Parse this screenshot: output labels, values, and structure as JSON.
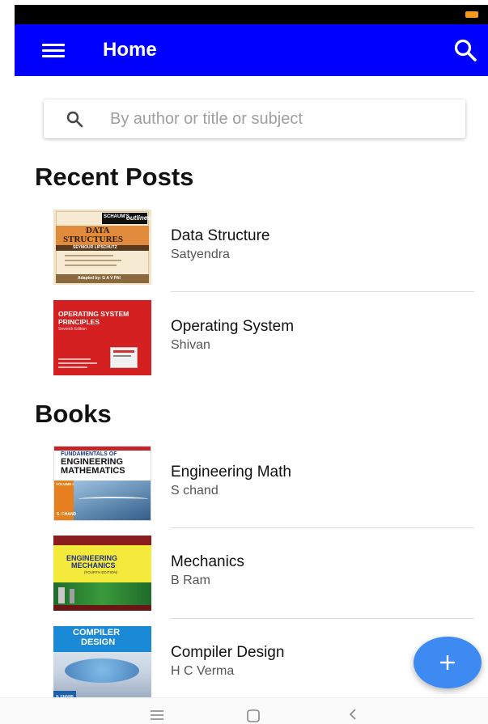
{
  "app_bar": {
    "title": "Home"
  },
  "search": {
    "placeholder": "By author or title or subject"
  },
  "sections": {
    "recent_title": "Recent Posts",
    "books_title": "Books"
  },
  "recent_posts": [
    {
      "title": "Data Structure",
      "author": "Satyendra",
      "cover": {
        "series": "SCHAUM'S",
        "series2": "outlines",
        "line1": "DATA",
        "line2": "STRUCTURES",
        "byline": "SEYMOUR LIPSCHUTZ",
        "footer": "Adapted by: G A V PAI"
      }
    },
    {
      "title": "Operating System",
      "author": "Shivan",
      "cover": {
        "line1": "OPERATING SYSTEM",
        "line2": "PRINCIPLES",
        "edition": "Seventh Edition"
      }
    }
  ],
  "books": [
    {
      "title": "Engineering Math",
      "author": "S chand",
      "cover": {
        "line1": "FUNDAMENTALS OF",
        "line2": "ENGINEERING",
        "line3": "MATHEMATICS",
        "volume": "VOLUME I",
        "publisher": "S. CHAND"
      }
    },
    {
      "title": "Mechanics",
      "author": "B Ram",
      "cover": {
        "line1": "ENGINEERING",
        "line2": "MECHANICS",
        "edition": "(FOURTH EDITION)"
      }
    },
    {
      "title": "Compiler Design",
      "author": "H C Verma",
      "cover": {
        "line1": "COMPILER",
        "line2": "DESIGN",
        "publisher": "S. CHAND"
      }
    }
  ],
  "icons": {
    "menu": "hamburger-menu-icon",
    "search": "search-icon",
    "add": "plus-icon",
    "nav_recents": "recents-icon",
    "nav_home": "home-square-icon",
    "nav_back": "back-chevron-icon"
  },
  "colors": {
    "app_bar": "#0000ff",
    "fab": "#3d8bf2",
    "status_bar": "#000000"
  }
}
